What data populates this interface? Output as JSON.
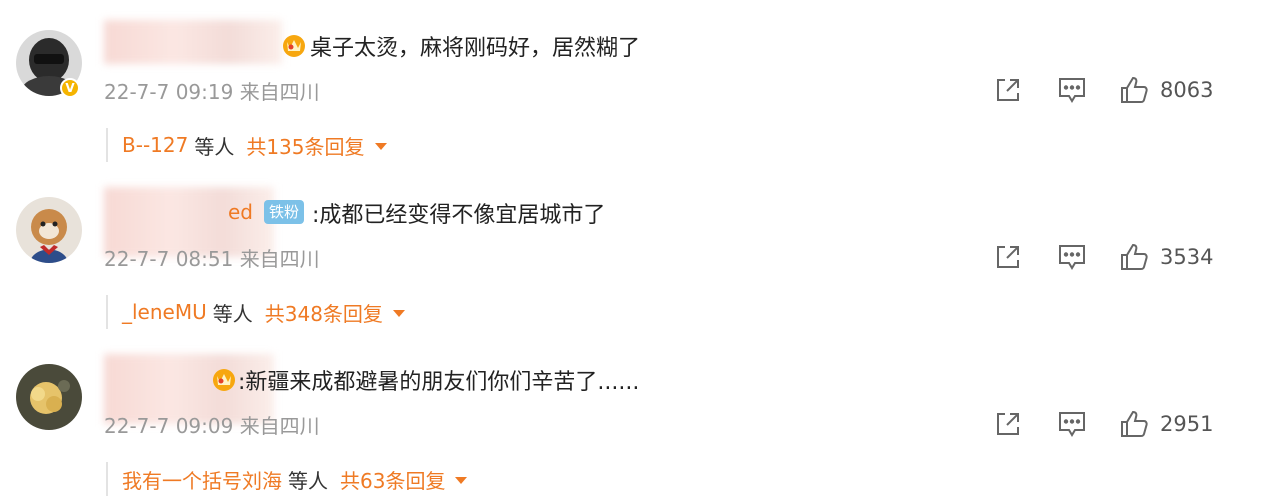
{
  "comments": [
    {
      "username_suffix": "",
      "badge": "crown",
      "text": "桌子太烫，麻将刚码好，居然糊了",
      "time": "22-7-7 09:19",
      "location": "来自四川",
      "likes": "8063",
      "reply_users": "B--127",
      "reply_deng": "等人",
      "reply_total": "共135条回复"
    },
    {
      "username_suffix": "ed",
      "badge": "fan",
      "fan_label": "铁粉",
      "text": ":成都已经变得不像宜居城市了",
      "time": "22-7-7 08:51",
      "location": "来自四川",
      "likes": "3534",
      "reply_users": "_leneMU",
      "reply_deng": "等人",
      "reply_total": "共348条回复"
    },
    {
      "username_suffix": "",
      "badge": "crown",
      "text": ":新疆来成都避暑的朋友们你们辛苦了......",
      "time": "22-7-7 09:09",
      "location": "来自四川",
      "likes": "2951",
      "reply_users": "我有一个括号刘海",
      "reply_deng": "等人",
      "reply_total": "共63条回复"
    }
  ],
  "colors": {
    "accent": "#ef7a24",
    "meta_gray": "#999999",
    "fan_badge": "#7cc1e8",
    "verify_badge": "#f5b400"
  },
  "icons": [
    "share-icon",
    "comment-icon",
    "like-icon",
    "crown-badge-icon",
    "verified-badge-icon",
    "caret-down-icon"
  ]
}
